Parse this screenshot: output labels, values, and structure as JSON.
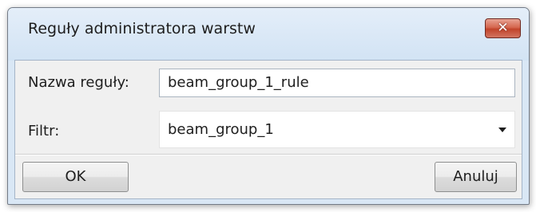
{
  "window": {
    "title": "Reguły administratora warstw",
    "close_icon": "close-icon"
  },
  "form": {
    "name_label": "Nazwa reguły:",
    "name_value": "beam_group_1_rule",
    "filter_label": "Filtr:",
    "filter_value": "beam_group_1",
    "filter_icon": "chevron-down-icon"
  },
  "buttons": {
    "ok_label": "OK",
    "cancel_label": "Anuluj"
  },
  "colors": {
    "titlebar": "#d9e7f5",
    "close_button": "#c1442b",
    "client_background": "#f0f0f0"
  }
}
